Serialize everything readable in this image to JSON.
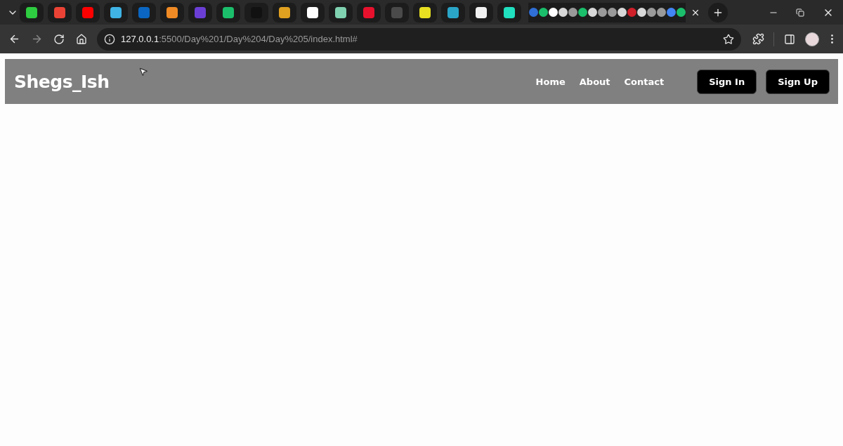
{
  "browser": {
    "pinned_tabs": [
      {
        "color": "#2ecc40"
      },
      {
        "color": "#ea4335"
      },
      {
        "color": "#ff0000"
      },
      {
        "color": "#3fb4e5"
      },
      {
        "color": "#0a66c2"
      },
      {
        "color": "#f08a24"
      },
      {
        "color": "#6b3fd6"
      },
      {
        "color": "#1bbf6b"
      },
      {
        "color": "#111111"
      },
      {
        "color": "#e0a020"
      },
      {
        "color": "#ffffff"
      },
      {
        "color": "#7fd1b0"
      },
      {
        "color": "#e8112d"
      },
      {
        "color": "#4a4a4a"
      },
      {
        "color": "#e8e020"
      },
      {
        "color": "#2aa5c8"
      },
      {
        "color": "#f2f2f2"
      },
      {
        "color": "#20e0c0"
      }
    ],
    "mini_tabs": [
      {
        "color": "#2f6fd6"
      },
      {
        "color": "#1bbf6b"
      },
      {
        "color": "#ffffff"
      },
      {
        "color": "#d8d8d8"
      },
      {
        "color": "#9a9a9a"
      },
      {
        "color": "#1bbf6b"
      },
      {
        "color": "#d8d8d8"
      },
      {
        "color": "#9a9a9a"
      },
      {
        "color": "#9a9a9a"
      },
      {
        "color": "#d8d8d8"
      },
      {
        "color": "#d0202a"
      },
      {
        "color": "#d8d8d8"
      },
      {
        "color": "#9a9a9a"
      },
      {
        "color": "#9a9a9a"
      },
      {
        "color": "#4285f4"
      },
      {
        "color": "#1bbf6b"
      }
    ],
    "url_host": "127.0.0.1",
    "url_path": ":5500/Day%201/Day%204/Day%205/index.html#"
  },
  "page": {
    "logo": "Shegs_Ish",
    "nav_links": [
      "Home",
      "About",
      "Contact"
    ],
    "buttons": [
      "Sign In",
      "Sign Up"
    ]
  }
}
